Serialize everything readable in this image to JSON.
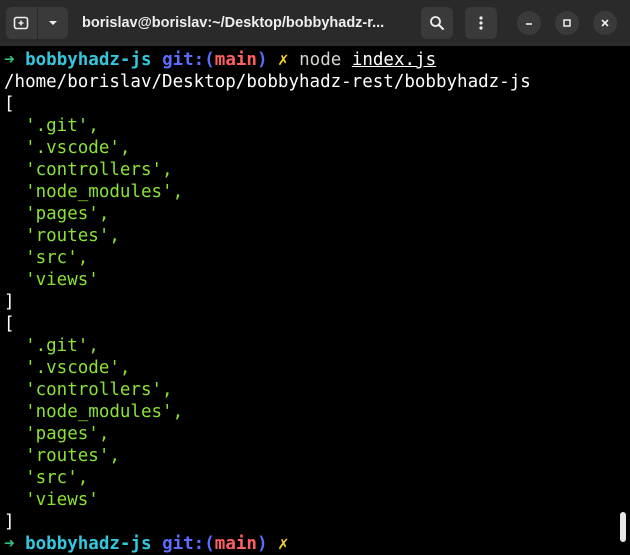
{
  "window": {
    "title": "borislav@borislav:~/Desktop/bobbyhadz-r..."
  },
  "prompt": {
    "arrow": "➜",
    "dir": "bobbyhadz-js",
    "git_label": "git:",
    "open_paren": "(",
    "branch": "main",
    "close_paren": ")",
    "dirty": "✗"
  },
  "command": {
    "name": "node",
    "arg": "index.js"
  },
  "output": {
    "cwd": "/home/borislav/Desktop/bobbyhadz-rest/bobbyhadz-js",
    "open_bracket": "[",
    "close_bracket": "]",
    "arrays": [
      [
        "'.git',",
        "'.vscode',",
        "'controllers',",
        "'node_modules',",
        "'pages',",
        "'routes',",
        "'src',",
        "'views'"
      ],
      [
        "'.git',",
        "'.vscode',",
        "'controllers',",
        "'node_modules',",
        "'pages',",
        "'routes',",
        "'src',",
        "'views'"
      ]
    ]
  }
}
